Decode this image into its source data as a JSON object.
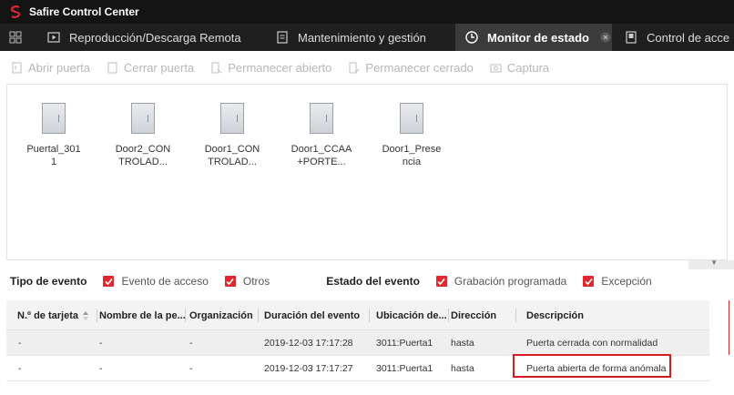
{
  "app": {
    "title": "Safire Control Center"
  },
  "tabs": [
    {
      "label": "Reproducción/Descarga Remota",
      "icon": "playback-icon"
    },
    {
      "label": "Mantenimiento y gestión",
      "icon": "maintenance-icon"
    },
    {
      "label": "Monitor de estado",
      "icon": "monitor-icon",
      "active": true
    },
    {
      "label": "Control de acce",
      "icon": "access-control-icon"
    }
  ],
  "toolbar": {
    "open_door": "Abrir puerta",
    "close_door": "Cerrar puerta",
    "remain_open": "Permanecer abierto",
    "remain_closed": "Permanecer cerrado",
    "capture": "Captura"
  },
  "devices": [
    {
      "name": "Puertal_301\n1"
    },
    {
      "name": "Door2_CON\nTROLAD..."
    },
    {
      "name": "Door1_CON\nTROLAD..."
    },
    {
      "name": "Door1_CCAA\n+PORTE..."
    },
    {
      "name": "Door1_Prese\nncia"
    }
  ],
  "filters": {
    "event_type_label": "Tipo de evento",
    "access_event": "Evento de acceso",
    "others": "Otros",
    "event_state_label": "Estado del evento",
    "scheduled_recording": "Grabación programada",
    "exception": "Excepción"
  },
  "table": {
    "headers": [
      "N.º de tarjeta",
      "Nombre de la pe...",
      "Organización",
      "Duración del evento",
      "Ubicación de...",
      "Dirección",
      "Descripción"
    ],
    "rows": [
      [
        "-",
        "-",
        "-",
        "2019-12-03 17:17:28",
        "3011:Puerta1",
        "hasta",
        "Puerta cerrada con normalidad"
      ],
      [
        "-",
        "-",
        "-",
        "2019-12-03 17:17:27",
        "3011:Puerta1",
        "hasta",
        "Puerta abierta de forma anómala"
      ]
    ]
  },
  "colors": {
    "accent_red": "#e0282e",
    "titlebar_bg": "#141414",
    "tabbar_bg": "#1f1f1f"
  }
}
